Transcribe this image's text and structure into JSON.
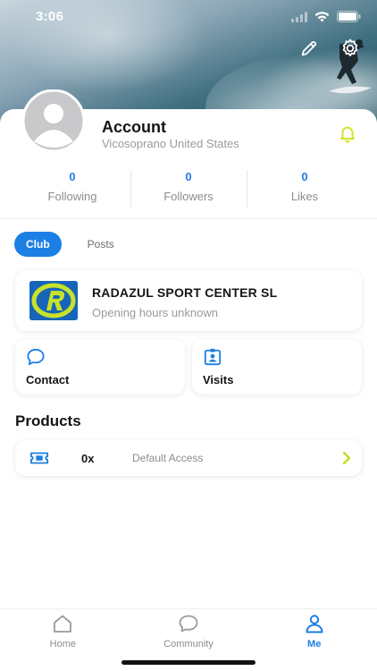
{
  "status_bar": {
    "time": "3:06"
  },
  "profile": {
    "name": "Account",
    "location": "Vicosoprano United States"
  },
  "stats": [
    {
      "value": "0",
      "label": "Following"
    },
    {
      "value": "0",
      "label": "Followers"
    },
    {
      "value": "0",
      "label": "Likes"
    }
  ],
  "tabs": [
    {
      "label": "Club",
      "active": true
    },
    {
      "label": "Posts",
      "active": false
    }
  ],
  "club": {
    "name": "RADAZUL SPORT CENTER SL",
    "hours": "Opening hours unknown",
    "logo_colors": {
      "background": "#1765b8",
      "ring": "#c8e12a"
    }
  },
  "actions": {
    "contact_label": "Contact",
    "visits_label": "Visits"
  },
  "products": {
    "title": "Products",
    "items": [
      {
        "quantity": "0x",
        "name": "Default Access"
      }
    ]
  },
  "bottom_nav": [
    {
      "label": "Home",
      "icon": "home-icon",
      "active": false
    },
    {
      "label": "Community",
      "icon": "chat-bubble-icon",
      "active": false
    },
    {
      "label": "Me",
      "icon": "person-icon",
      "active": true
    }
  ],
  "colors": {
    "accent": "#1c7fe3",
    "bell": "#cfe223",
    "chevron": "#c6dc1f"
  }
}
